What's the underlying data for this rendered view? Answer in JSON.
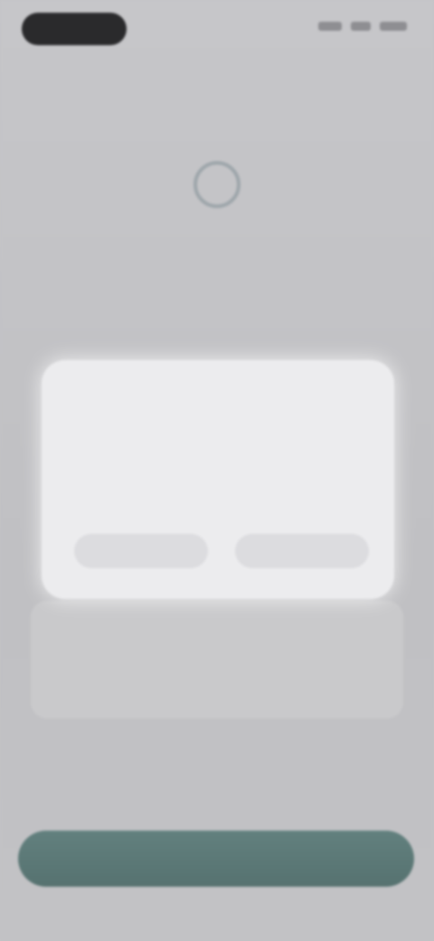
{
  "status_bar": {
    "time": "",
    "icons": [
      "signal-icon",
      "wifi-icon",
      "battery-icon"
    ]
  },
  "page": {
    "title": "",
    "subtitle": "",
    "card_text": ""
  },
  "dialog": {
    "title": "",
    "body": "",
    "left_button": "",
    "right_button": ""
  },
  "primary_button": {
    "label": ""
  },
  "colors": {
    "background": "#c3c3c6",
    "dialog": "#ececee",
    "primary": "#5a7775"
  }
}
